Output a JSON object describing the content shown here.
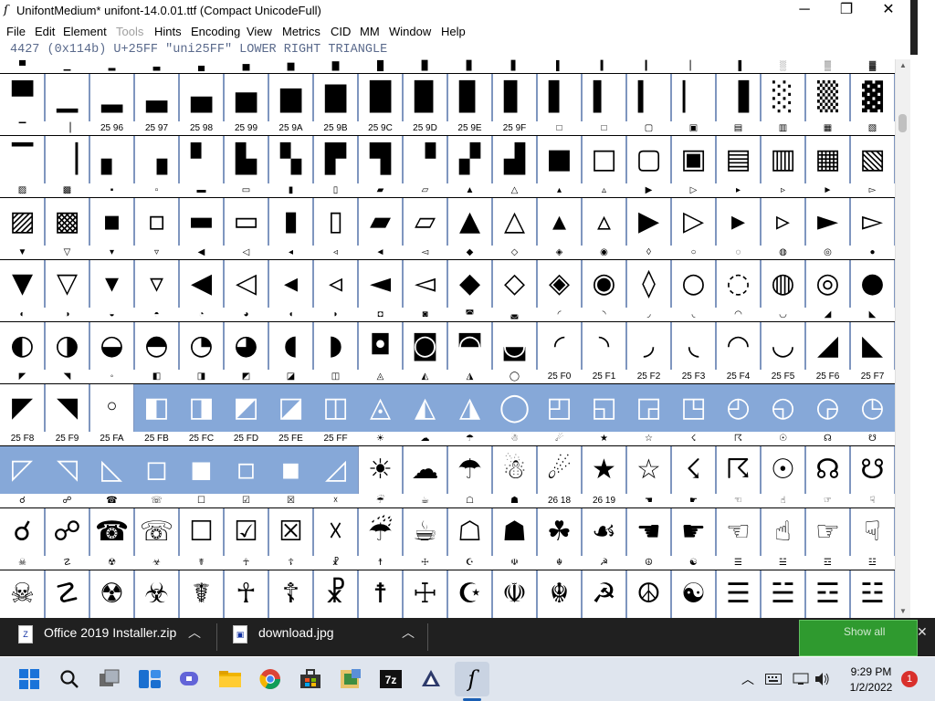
{
  "window": {
    "title": "UnifontMedium*  unifont-14.0.01.ttf (Compact UnicodeFull)",
    "minimize": "─",
    "maximize": "❐",
    "close": "✕"
  },
  "menu": [
    {
      "label": "File",
      "enabled": true
    },
    {
      "label": "Edit",
      "enabled": true
    },
    {
      "label": "Element",
      "enabled": true
    },
    {
      "label": "Tools",
      "enabled": false
    },
    {
      "label": "Hints",
      "enabled": true
    },
    {
      "label": "Encoding",
      "enabled": true
    },
    {
      "label": "View",
      "enabled": true
    },
    {
      "label": "Metrics",
      "enabled": true
    },
    {
      "label": "CID",
      "enabled": true
    },
    {
      "label": "MM",
      "enabled": true
    },
    {
      "label": "Window",
      "enabled": true
    },
    {
      "label": "Help",
      "enabled": true
    }
  ],
  "info": "4427 (0x114b) U+25FF \"uni25FF\" LOWER RIGHT TRIANGLE",
  "grid": {
    "rows": [
      {
        "labels": [
          "▀",
          "▁",
          "▂",
          "▃",
          "▄",
          "▅",
          "▆",
          "▇",
          "█",
          "▉",
          "▊",
          "▋",
          "▌",
          "▍",
          "▎",
          "▏",
          "▐",
          "░",
          "▒",
          "▓"
        ],
        "glyphs": [
          "▀",
          "▁",
          "▂",
          "▃",
          "▄",
          "▅",
          "▆",
          "▇",
          "█",
          "▉",
          "▊",
          "▋",
          "▌",
          "▍",
          "▎",
          "▏",
          "▐",
          "░",
          "▒",
          "▓"
        ],
        "selected": []
      },
      {
        "labels": [
          "▔",
          "▕",
          "25 96",
          "25 97",
          "25 98",
          "25 99",
          "25 9A",
          "25 9B",
          "25 9C",
          "25 9D",
          "25 9E",
          "25 9F",
          "□",
          "□",
          "▢",
          "▣",
          "▤",
          "▥",
          "▦",
          "▧"
        ],
        "glyphs": [
          "▔",
          "▕",
          "▖",
          "▗",
          "▘",
          "▙",
          "▚",
          "▛",
          "▜",
          "▝",
          "▞",
          "▟",
          "■",
          "□",
          "▢",
          "▣",
          "▤",
          "▥",
          "▦",
          "▧"
        ],
        "selected": []
      },
      {
        "labels": [
          "▨",
          "▩",
          "▪",
          "▫",
          "▬",
          "▭",
          "▮",
          "▯",
          "▰",
          "▱",
          "▲",
          "△",
          "▴",
          "▵",
          "▶",
          "▷",
          "▸",
          "▹",
          "►",
          "▻"
        ],
        "glyphs": [
          "▨",
          "▩",
          "▪",
          "▫",
          "▬",
          "▭",
          "▮",
          "▯",
          "▰",
          "▱",
          "▲",
          "△",
          "▴",
          "▵",
          "▶",
          "▷",
          "▸",
          "▹",
          "►",
          "▻"
        ],
        "selected": []
      },
      {
        "labels": [
          "▼",
          "▽",
          "▾",
          "▿",
          "◀",
          "◁",
          "◂",
          "◃",
          "◄",
          "◅",
          "◆",
          "◇",
          "◈",
          "◉",
          "◊",
          "○",
          "◌",
          "◍",
          "◎",
          "●"
        ],
        "glyphs": [
          "▼",
          "▽",
          "▾",
          "▿",
          "◀",
          "◁",
          "◂",
          "◃",
          "◄",
          "◅",
          "◆",
          "◇",
          "◈",
          "◉",
          "◊",
          "○",
          "◌",
          "◍",
          "◎",
          "●"
        ],
        "selected": []
      },
      {
        "labels": [
          "◐",
          "◑",
          "◒",
          "◓",
          "◔",
          "◕",
          "◖",
          "◗",
          "◘",
          "◙",
          "◚",
          "◛",
          "◜",
          "◝",
          "◞",
          "◟",
          "◠",
          "◡",
          "◢",
          "◣"
        ],
        "glyphs": [
          "◐",
          "◑",
          "◒",
          "◓",
          "◔",
          "◕",
          "◖",
          "◗",
          "◘",
          "◙",
          "◚",
          "◛",
          "◜",
          "◝",
          "◞",
          "◟",
          "◠",
          "◡",
          "◢",
          "◣"
        ],
        "selected": []
      },
      {
        "labels": [
          "◤",
          "◥",
          "◦",
          "◧",
          "◨",
          "◩",
          "◪",
          "◫",
          "◬",
          "◭",
          "◮",
          "◯",
          "25 F0",
          "25 F1",
          "25 F2",
          "25 F3",
          "25 F4",
          "25 F5",
          "25 F6",
          "25 F7"
        ],
        "glyphs": [
          "◤",
          "◥",
          "◦",
          "◧",
          "◨",
          "◩",
          "◪",
          "◫",
          "◬",
          "◭",
          "◮",
          "◯",
          "◰",
          "◱",
          "◲",
          "◳",
          "◴",
          "◵",
          "◶",
          "◷"
        ],
        "selected": [
          3,
          4,
          5,
          6,
          7,
          8,
          9,
          10,
          11,
          12,
          13,
          14,
          15,
          16,
          17,
          18,
          19
        ]
      },
      {
        "labels": [
          "25 F8",
          "25 F9",
          "25 FA",
          "25 FB",
          "25 FC",
          "25 FD",
          "25 FE",
          "25 FF",
          "☀",
          "☁",
          "☂",
          "☃",
          "☄",
          "★",
          "☆",
          "☇",
          "☈",
          "☉",
          "☊",
          "☋"
        ],
        "glyphs": [
          "◸",
          "◹",
          "◺",
          "◻",
          "◼",
          "◽",
          "◾",
          "◿",
          "☀",
          "☁",
          "☂",
          "☃",
          "☄",
          "★",
          "☆",
          "☇",
          "☈",
          "☉",
          "☊",
          "☋"
        ],
        "selected": [
          0,
          1,
          2,
          3,
          4,
          5,
          6,
          7
        ]
      },
      {
        "labels": [
          "☌",
          "☍",
          "☎",
          "☏",
          "☐",
          "☑",
          "☒",
          "☓",
          "☔",
          "☕",
          "☖",
          "☗",
          "26 18",
          "26 19",
          "☚",
          "☛",
          "☜",
          "☝",
          "☞",
          "☟"
        ],
        "glyphs": [
          "☌",
          "☍",
          "☎",
          "☏",
          "☐",
          "☑",
          "☒",
          "☓",
          "☔",
          "☕",
          "☖",
          "☗",
          "☘",
          "☙",
          "☚",
          "☛",
          "☜",
          "☝",
          "☞",
          "☟"
        ],
        "selected": []
      },
      {
        "labels": [
          "☠",
          "☡",
          "☢",
          "☣",
          "☤",
          "☥",
          "☦",
          "☧",
          "☨",
          "☩",
          "☪",
          "☫",
          "☬",
          "☭",
          "☮",
          "☯",
          "☰",
          "☱",
          "☲",
          "☳"
        ],
        "glyphs": [
          "☠",
          "☡",
          "☢",
          "☣",
          "☤",
          "☥",
          "☦",
          "☧",
          "☨",
          "☩",
          "☪",
          "☫",
          "☬",
          "☭",
          "☮",
          "☯",
          "☰",
          "☱",
          "☲",
          "☳"
        ],
        "selected": []
      }
    ]
  },
  "downloads": [
    {
      "name": "Office 2019 Installer.zip",
      "icon": "zip-file-icon"
    },
    {
      "name": "download.jpg",
      "icon": "image-file-icon"
    }
  ],
  "notification": {
    "text": "Show all",
    "close": "✕"
  },
  "taskbar": {
    "icons": [
      "windows-start-icon",
      "search-icon",
      "task-view-icon",
      "widgets-icon",
      "teams-chat-icon",
      "file-explorer-icon",
      "chrome-icon",
      "store-icon",
      "app-icon",
      "7zip-icon",
      "inkscape-icon",
      "fontforge-icon"
    ],
    "time": "9:29 PM",
    "date": "1/2/2022",
    "badge": "1"
  }
}
